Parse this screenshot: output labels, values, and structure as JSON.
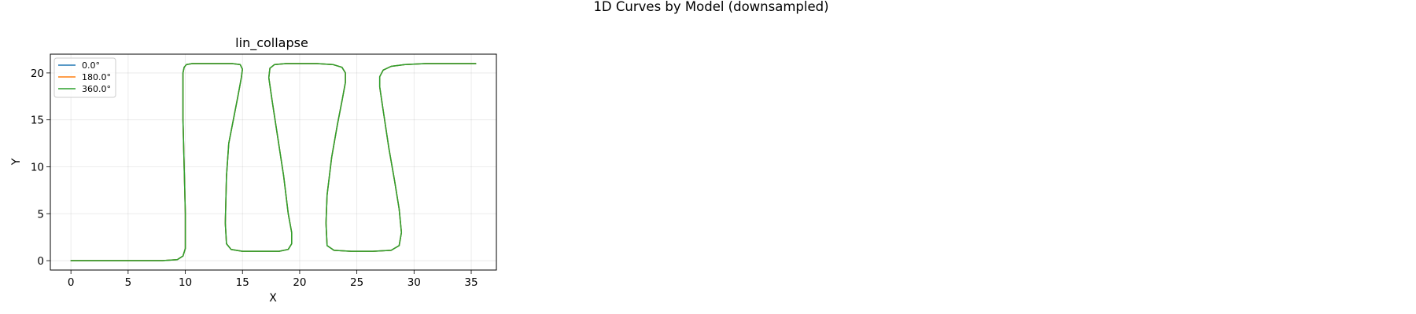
{
  "figure": {
    "suptitle": "1D Curves by Model (downsampled)"
  },
  "chart_data": {
    "type": "line",
    "title": "lin_collapse",
    "xlabel": "X",
    "ylabel": "Y",
    "xlim": [
      -1.8,
      37.2
    ],
    "ylim": [
      -1.0,
      22.0
    ],
    "xticks": [
      0,
      5,
      10,
      15,
      20,
      25,
      30,
      35
    ],
    "yticks": [
      0,
      5,
      10,
      15,
      20
    ],
    "grid": true,
    "legend_position": "upper-left",
    "series": [
      {
        "name": "0.0°",
        "color": "#1f77b4",
        "x": [
          0,
          4,
          8,
          9.3,
          9.8,
          10.0,
          10.0,
          9.9,
          9.8,
          9.8,
          9.8,
          9.9,
          10.1,
          10.6,
          11.5,
          12.8,
          14.1,
          14.8,
          15.0,
          14.9,
          14.6,
          14.2,
          13.8,
          13.6,
          13.5,
          13.6,
          14.0,
          15.0,
          16.6,
          18.2,
          19.0,
          19.3,
          19.3,
          19.0,
          18.6,
          18.1,
          17.6,
          17.3,
          17.4,
          17.8,
          18.8,
          20.0,
          21.5,
          22.9,
          23.7,
          24.0,
          24.0,
          23.7,
          23.3,
          22.8,
          22.4,
          22.3,
          22.4,
          23.0,
          24.5,
          26.4,
          28.0,
          28.7,
          28.9,
          28.7,
          28.3,
          27.8,
          27.3,
          27.0,
          27.0,
          27.3,
          28.0,
          29.2,
          31.0,
          33.5,
          35.4
        ],
        "y": [
          0,
          0,
          0,
          0.1,
          0.5,
          1.3,
          5,
          10,
          15,
          18,
          20,
          20.6,
          20.9,
          21,
          21,
          21,
          21,
          20.9,
          20.4,
          19.5,
          17.5,
          15,
          12.5,
          9,
          4,
          1.8,
          1.2,
          1.0,
          1.0,
          1.0,
          1.2,
          1.8,
          3,
          5,
          9,
          13,
          17,
          19.5,
          20.5,
          20.9,
          21.0,
          21.0,
          21.0,
          20.9,
          20.6,
          20,
          19,
          17,
          14.5,
          11,
          7,
          4,
          1.6,
          1.1,
          1.0,
          1.0,
          1.1,
          1.6,
          3.0,
          5.5,
          8.5,
          12,
          16,
          18.5,
          19.6,
          20.3,
          20.7,
          20.9,
          21.0,
          21.0,
          21.0
        ]
      },
      {
        "name": "180.0°",
        "color": "#ff7f0e",
        "x": [
          0,
          4,
          8,
          9.3,
          9.8,
          10.0,
          10.0,
          9.9,
          9.8,
          9.8,
          9.8,
          9.9,
          10.1,
          10.6,
          11.5,
          12.8,
          14.1,
          14.8,
          15.0,
          14.9,
          14.6,
          14.2,
          13.8,
          13.6,
          13.5,
          13.6,
          14.0,
          15.0,
          16.6,
          18.2,
          19.0,
          19.3,
          19.3,
          19.0,
          18.6,
          18.1,
          17.6,
          17.3,
          17.4,
          17.8,
          18.8,
          20.0,
          21.5,
          22.9,
          23.7,
          24.0,
          24.0,
          23.7,
          23.3,
          22.8,
          22.4,
          22.3,
          22.4,
          23.0,
          24.5,
          26.4,
          28.0,
          28.7,
          28.9,
          28.7,
          28.3,
          27.8,
          27.3,
          27.0,
          27.0,
          27.3,
          28.0,
          29.2,
          31.0,
          33.5,
          35.4
        ],
        "y": [
          0,
          0,
          0,
          0.1,
          0.5,
          1.3,
          5,
          10,
          15,
          18,
          20,
          20.6,
          20.9,
          21,
          21,
          21,
          21,
          20.9,
          20.4,
          19.5,
          17.5,
          15,
          12.5,
          9,
          4,
          1.8,
          1.2,
          1.0,
          1.0,
          1.0,
          1.2,
          1.8,
          3,
          5,
          9,
          13,
          17,
          19.5,
          20.5,
          20.9,
          21.0,
          21.0,
          21.0,
          20.9,
          20.6,
          20,
          19,
          17,
          14.5,
          11,
          7,
          4,
          1.6,
          1.1,
          1.0,
          1.0,
          1.1,
          1.6,
          3.0,
          5.5,
          8.5,
          12,
          16,
          18.5,
          19.6,
          20.3,
          20.7,
          20.9,
          21.0,
          21.0,
          21.0
        ]
      },
      {
        "name": "360.0°",
        "color": "#2ca02c",
        "x": [
          0,
          4,
          8,
          9.3,
          9.8,
          10.0,
          10.0,
          9.9,
          9.8,
          9.8,
          9.8,
          9.9,
          10.1,
          10.6,
          11.5,
          12.8,
          14.1,
          14.8,
          15.0,
          14.9,
          14.6,
          14.2,
          13.8,
          13.6,
          13.5,
          13.6,
          14.0,
          15.0,
          16.6,
          18.2,
          19.0,
          19.3,
          19.3,
          19.0,
          18.6,
          18.1,
          17.6,
          17.3,
          17.4,
          17.8,
          18.8,
          20.0,
          21.5,
          22.9,
          23.7,
          24.0,
          24.0,
          23.7,
          23.3,
          22.8,
          22.4,
          22.3,
          22.4,
          23.0,
          24.5,
          26.4,
          28.0,
          28.7,
          28.9,
          28.7,
          28.3,
          27.8,
          27.3,
          27.0,
          27.0,
          27.3,
          28.0,
          29.2,
          31.0,
          33.5,
          35.4
        ],
        "y": [
          0,
          0,
          0,
          0.1,
          0.5,
          1.3,
          5,
          10,
          15,
          18,
          20,
          20.6,
          20.9,
          21,
          21,
          21,
          21,
          20.9,
          20.4,
          19.5,
          17.5,
          15,
          12.5,
          9,
          4,
          1.8,
          1.2,
          1.0,
          1.0,
          1.0,
          1.2,
          1.8,
          3,
          5,
          9,
          13,
          17,
          19.5,
          20.5,
          20.9,
          21.0,
          21.0,
          21.0,
          20.9,
          20.6,
          20,
          19,
          17,
          14.5,
          11,
          7,
          4,
          1.6,
          1.1,
          1.0,
          1.0,
          1.1,
          1.6,
          3.0,
          5.5,
          8.5,
          12,
          16,
          18.5,
          19.6,
          20.3,
          20.7,
          20.9,
          21.0,
          21.0,
          21.0
        ]
      }
    ]
  }
}
